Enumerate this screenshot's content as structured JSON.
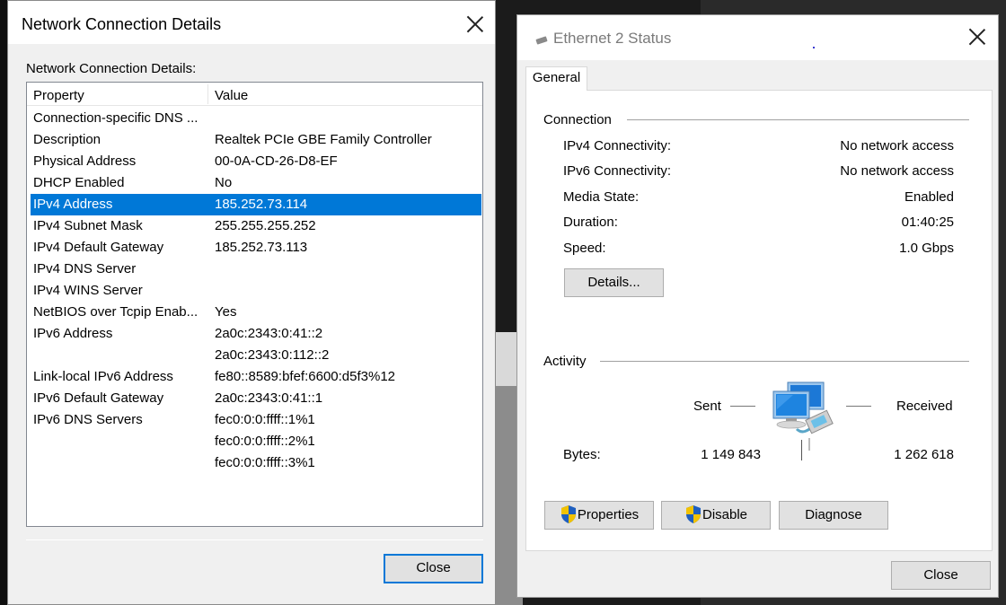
{
  "left_dialog": {
    "title": "Network Connection Details",
    "group_label": "Network Connection Details:",
    "columns": {
      "property": "Property",
      "value": "Value"
    },
    "rows": [
      {
        "property": "Connection-specific DNS ...",
        "value": ""
      },
      {
        "property": "Description",
        "value": "Realtek PCIe GBE Family Controller"
      },
      {
        "property": "Physical Address",
        "value": "00-0A-CD-26-D8-EF"
      },
      {
        "property": "DHCP Enabled",
        "value": "No"
      },
      {
        "property": "IPv4 Address",
        "value": "185.252.73.114",
        "selected": true
      },
      {
        "property": "IPv4 Subnet Mask",
        "value": "255.255.255.252"
      },
      {
        "property": "IPv4 Default Gateway",
        "value": "185.252.73.113"
      },
      {
        "property": "IPv4 DNS Server",
        "value": ""
      },
      {
        "property": "IPv4 WINS Server",
        "value": ""
      },
      {
        "property": "NetBIOS over Tcpip Enab...",
        "value": "Yes"
      },
      {
        "property": "IPv6 Address",
        "value": "2a0c:2343:0:41::2"
      },
      {
        "property": "",
        "value": "2a0c:2343:0:112::2"
      },
      {
        "property": "Link-local IPv6 Address",
        "value": "fe80::8589:bfef:6600:d5f3%12"
      },
      {
        "property": "IPv6 Default Gateway",
        "value": "2a0c:2343:0:41::1"
      },
      {
        "property": "IPv6 DNS Servers",
        "value": "fec0:0:0:ffff::1%1"
      },
      {
        "property": "",
        "value": "fec0:0:0:ffff::2%1"
      },
      {
        "property": "",
        "value": "fec0:0:0:ffff::3%1"
      }
    ],
    "close_label": "Close",
    "close_icon": "close-icon"
  },
  "right_dialog": {
    "title": "Ethernet 2 Status",
    "tab_label": "General",
    "connection": {
      "heading": "Connection",
      "ipv4_label": "IPv4 Connectivity:",
      "ipv4_value": "No network access",
      "ipv6_label": "IPv6 Connectivity:",
      "ipv6_value": "No network access",
      "media_label": "Media State:",
      "media_value": "Enabled",
      "duration_label": "Duration:",
      "duration_value": "01:40:25",
      "speed_label": "Speed:",
      "speed_value": "1.0 Gbps",
      "details_label": "Details..."
    },
    "activity": {
      "heading": "Activity",
      "sent_label": "Sent",
      "received_label": "Received",
      "bytes_label": "Bytes:",
      "bytes_sent": "1 149 843",
      "bytes_received": "1 262 618"
    },
    "buttons": {
      "properties": "Properties",
      "disable": "Disable",
      "diagnose": "Diagnose",
      "close": "Close"
    },
    "icons": [
      "ethernet-icon",
      "network-computers-icon",
      "uac-shield-icon",
      "close-icon"
    ],
    "colors": {
      "selection": "#0078d7",
      "accent": "#0078d7"
    }
  }
}
